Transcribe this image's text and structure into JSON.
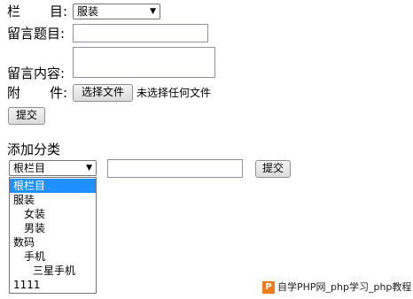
{
  "form": {
    "column_label_left": "栏",
    "column_label_right": "目:",
    "column_select_value": "服装",
    "title_label": "留言题目:",
    "title_value": "",
    "content_label": "留言内容:",
    "content_value": "",
    "attach_label_left": "附",
    "attach_label_right": "件:",
    "file_button_label": "选择文件",
    "file_status": "未选择任何文件",
    "submit_label": "提交"
  },
  "category": {
    "heading": "添加分类",
    "parent_select_value": "根栏目",
    "name_value": "",
    "submit_label": "提交",
    "options": [
      {
        "label": "根栏目",
        "level": 0,
        "selected": true
      },
      {
        "label": "服装",
        "level": 0,
        "selected": false
      },
      {
        "label": "女装",
        "level": 1,
        "selected": false
      },
      {
        "label": "男装",
        "level": 1,
        "selected": false
      },
      {
        "label": "数码",
        "level": 0,
        "selected": false
      },
      {
        "label": "手机",
        "level": 1,
        "selected": false
      },
      {
        "label": "三星手机",
        "level": 2,
        "selected": false
      },
      {
        "label": "1111",
        "level": 0,
        "selected": false
      }
    ]
  },
  "watermark": {
    "logo_letter": "P",
    "text": "自学PHP网_php学习_php教程"
  },
  "colors": {
    "highlight": "#1e90ff",
    "watermark_logo": "#f07b1e"
  }
}
